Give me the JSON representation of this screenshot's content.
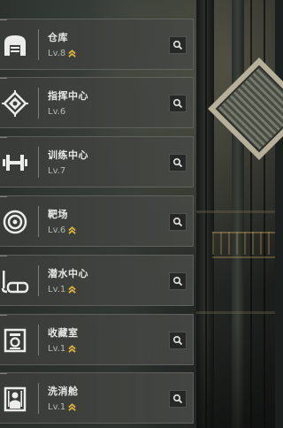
{
  "colors": {
    "accent_upgrade": "#e2b43a",
    "card_bg": "#3c3e3b",
    "text_primary": "#e9e9e6",
    "text_secondary": "#b7b8b3"
  },
  "facilities": [
    {
      "name": "仓库",
      "level": "Lv.8",
      "upgradable": true,
      "icon": "warehouse-icon"
    },
    {
      "name": "指挥中心",
      "level": "Lv.6",
      "upgradable": false,
      "icon": "command-center-icon"
    },
    {
      "name": "训练中心",
      "level": "Lv.7",
      "upgradable": false,
      "icon": "dumbbell-icon"
    },
    {
      "name": "靶场",
      "level": "Lv.6",
      "upgradable": true,
      "icon": "target-icon"
    },
    {
      "name": "潜水中心",
      "level": "Lv.1",
      "upgradable": true,
      "icon": "diving-mask-icon"
    },
    {
      "name": "收藏室",
      "level": "Lv.1",
      "upgradable": true,
      "icon": "collection-room-icon"
    },
    {
      "name": "洗消舱",
      "level": "Lv.1",
      "upgradable": true,
      "icon": "decontamination-icon"
    }
  ]
}
